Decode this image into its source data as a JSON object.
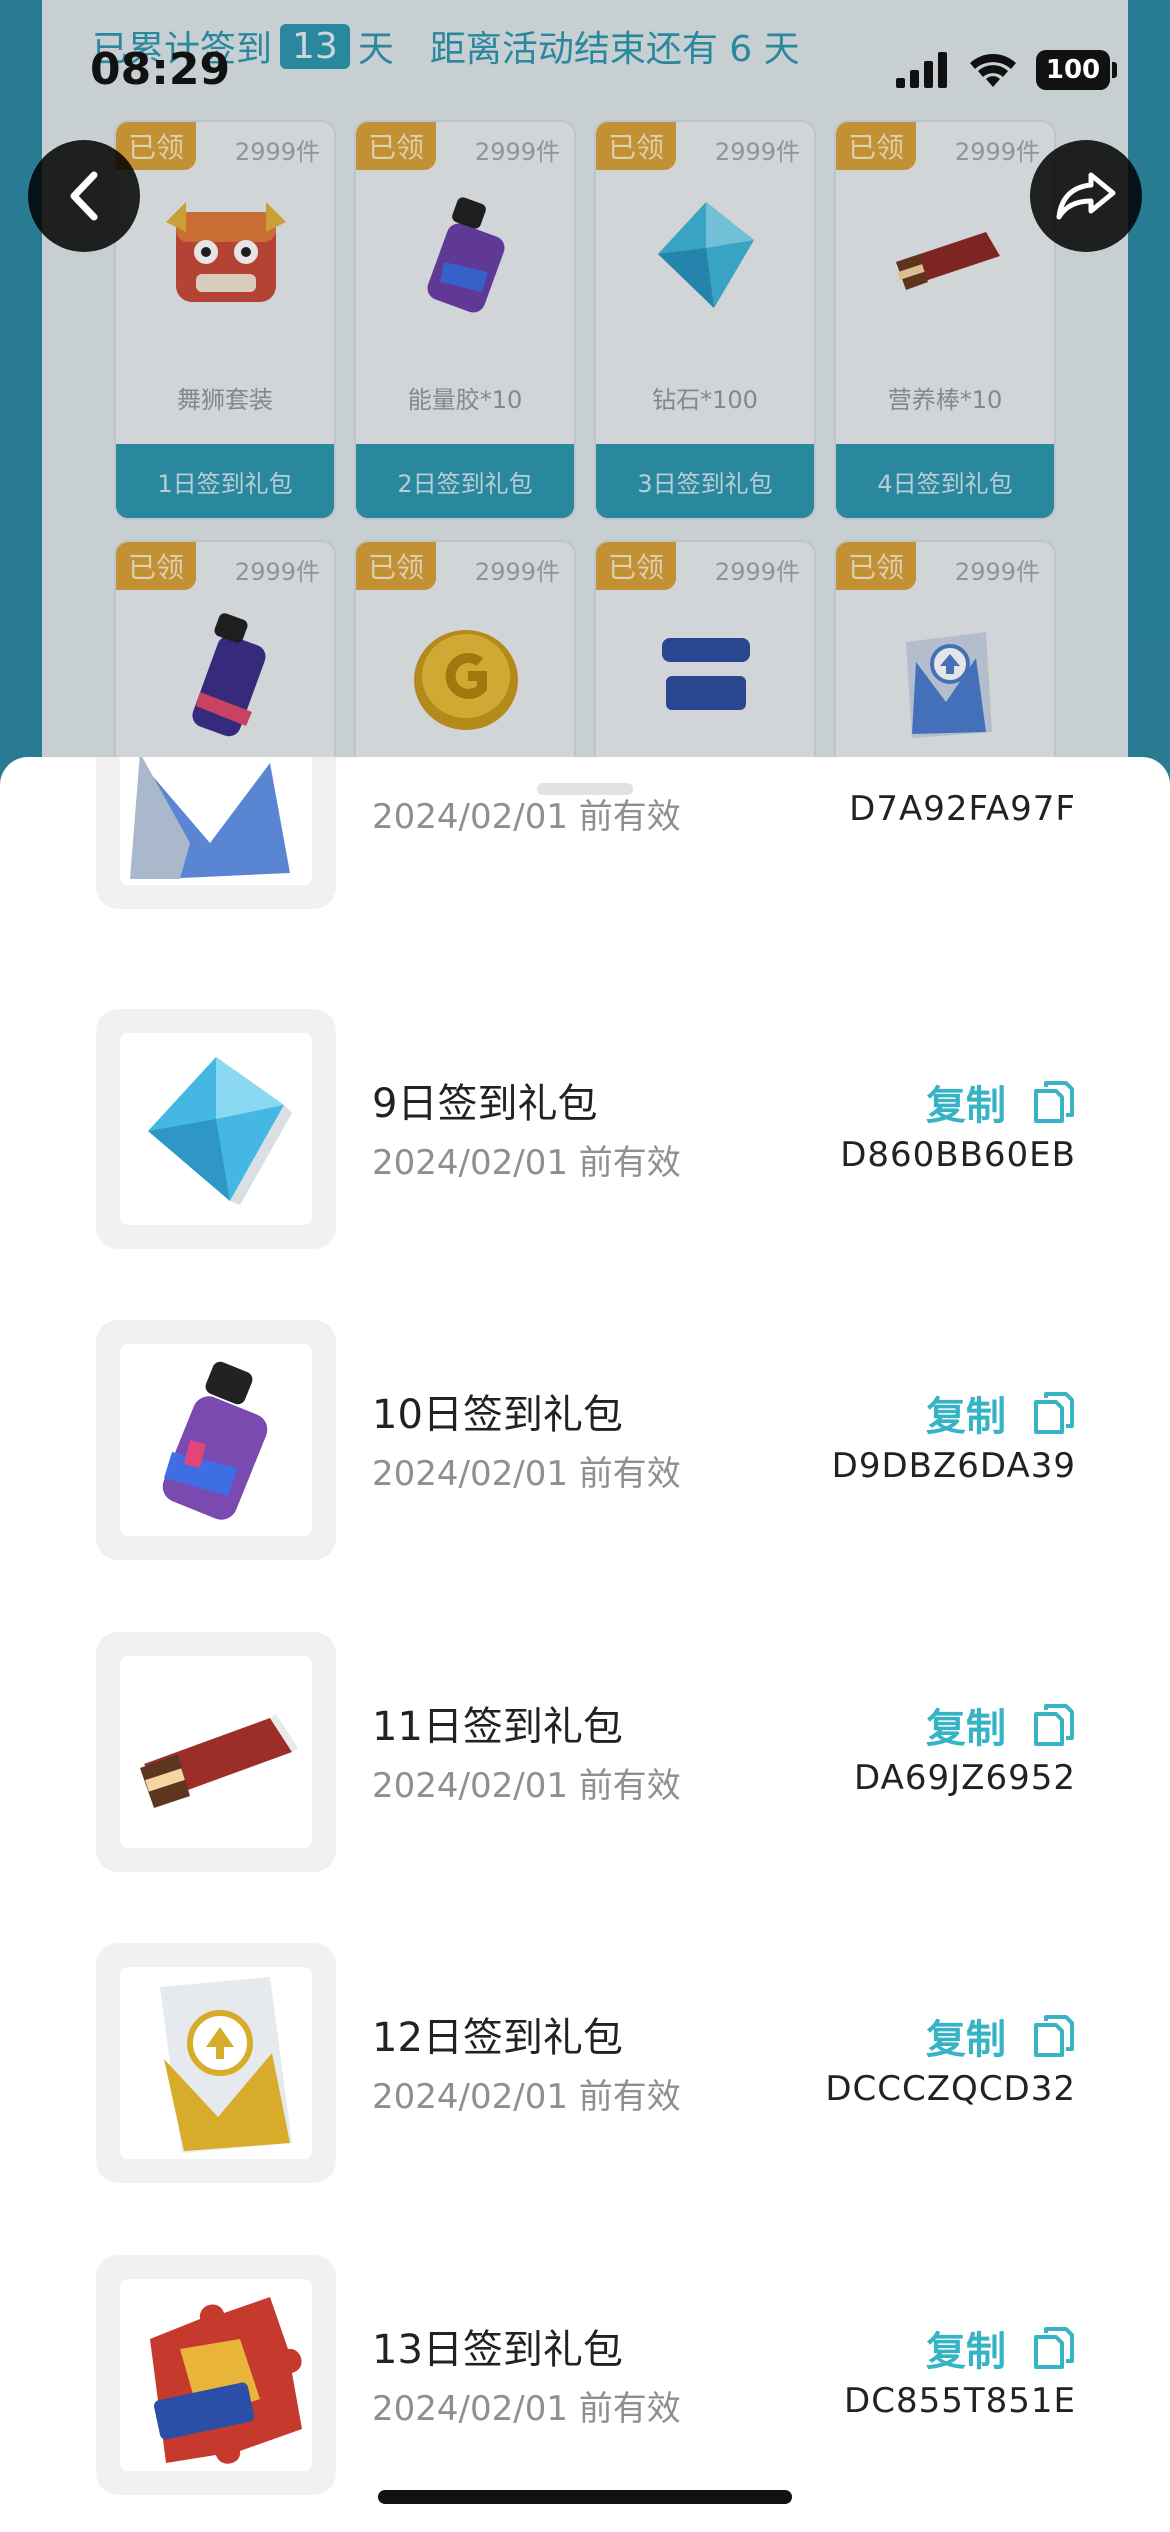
{
  "status": {
    "time": "08:29",
    "battery": "100"
  },
  "background": {
    "info_prefix": "已累计签到",
    "days": "13",
    "info_unit": "天",
    "info_suffix": "距离活动结束还有 6 天",
    "cards": [
      {
        "tag": "已领",
        "qty": "2999件",
        "name": "舞狮套装",
        "footer": "1日签到礼包",
        "icon": "lion-mask-icon"
      },
      {
        "tag": "已领",
        "qty": "2999件",
        "name": "能量胶*10",
        "footer": "2日签到礼包",
        "icon": "energy-gel-icon"
      },
      {
        "tag": "已领",
        "qty": "2999件",
        "name": "钻石*100",
        "footer": "3日签到礼包",
        "icon": "diamond-icon"
      },
      {
        "tag": "已领",
        "qty": "2999件",
        "name": "营养棒*10",
        "footer": "4日签到礼包",
        "icon": "nutrition-bar-icon"
      },
      {
        "tag": "已领",
        "qty": "2999件",
        "icon": "spray-can-icon"
      },
      {
        "tag": "已领",
        "qty": "2999件",
        "icon": "gold-coin-icon"
      },
      {
        "tag": "已领",
        "qty": "2999件",
        "icon": "protein-jar-icon"
      },
      {
        "tag": "已领",
        "qty": "2999件",
        "icon": "upgrade-card-icon"
      }
    ]
  },
  "sheet": {
    "partial_item": {
      "expire": "2024/02/01 前有效",
      "code": "D7A92FA97F"
    },
    "copy_label": "复制",
    "items": [
      {
        "title": "9日签到礼包",
        "expire": "2024/02/01 前有效",
        "code": "D860BB60EB",
        "icon": "diamond-icon"
      },
      {
        "title": "10日签到礼包",
        "expire": "2024/02/01 前有效",
        "code": "D9DBZ6DA39",
        "icon": "energy-gel-icon"
      },
      {
        "title": "11日签到礼包",
        "expire": "2024/02/01 前有效",
        "code": "DA69JZ6952",
        "icon": "nutrition-bar-icon"
      },
      {
        "title": "12日签到礼包",
        "expire": "2024/02/01 前有效",
        "code": "DCCCZQCD32",
        "icon": "gold-card-icon"
      },
      {
        "title": "13日签到礼包",
        "expire": "2024/02/01 前有效",
        "code": "DC855T851E",
        "icon": "puzzle-piece-icon"
      }
    ]
  },
  "colors": {
    "accent": "#37b3c6",
    "bg_teal": "#2d8aa3",
    "tag_gold": "#d9a23a"
  }
}
